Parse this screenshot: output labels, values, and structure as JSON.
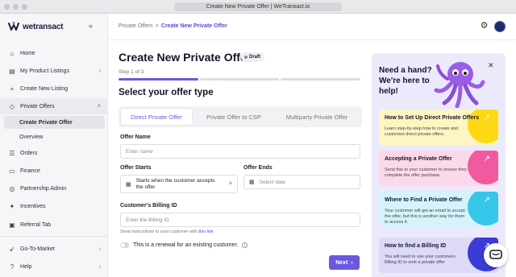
{
  "browser": {
    "title": "Create New Private Offer | WeTransact.io"
  },
  "brand": {
    "name": "wetransact",
    "accent": "#6a59de"
  },
  "sidebar": {
    "items": [
      {
        "label": "Home",
        "icon": "home-icon"
      },
      {
        "label": "My Product Listings",
        "icon": "listings-icon"
      },
      {
        "label": "Create New Listing",
        "icon": "plus-icon"
      },
      {
        "label": "Private Offers",
        "icon": "tag-icon"
      },
      {
        "label": "Orders",
        "icon": "orders-icon"
      },
      {
        "label": "Finance",
        "icon": "finance-icon"
      },
      {
        "label": "Partnership Admin",
        "icon": "partnership-icon"
      },
      {
        "label": "Incentives",
        "icon": "incentives-icon"
      },
      {
        "label": "Referral Tab",
        "icon": "referral-icon"
      },
      {
        "label": "Go-To-Market",
        "icon": "rocket-icon"
      },
      {
        "label": "Help",
        "icon": "help-icon"
      }
    ],
    "private_offers_sub": [
      "Create Private Offer",
      "Overview"
    ]
  },
  "header": {
    "crumbs": {
      "parent": "Private Offers",
      "sep": ">",
      "current": "Create New Private Offer"
    }
  },
  "main": {
    "title": "Create New Private Offer",
    "draft_badge": "Draft",
    "step": "Step 1 of 3",
    "progress": {
      "current_step": 1,
      "total_steps": 3
    },
    "section_title": "Select your offer type",
    "tabs": [
      "Direct Private Offer",
      "Private Offer to CSP",
      "Multiparty Private Offer"
    ],
    "offer_name": {
      "label": "Offer Name",
      "placeholder": "Enter name"
    },
    "offer_starts": {
      "label": "Offer Starts",
      "value": "Starts when the customer accepts the offer"
    },
    "offer_ends": {
      "label": "Offer Ends",
      "placeholder": "Select date"
    },
    "billing_id": {
      "label": "Customer's Billing ID",
      "placeholder": "Enter the Billing ID"
    },
    "hint": {
      "text": "Send instructions to your customer with",
      "link": "this link"
    },
    "renewal_label": "This is a renewal for an existing customer.",
    "next_label": "Next"
  },
  "help": {
    "title": "Need a hand? We're here to help!",
    "cards": [
      {
        "title": "How to Set Up Direct Private Offers",
        "desc": "Learn step-by-step how to create and customize direct private offers.",
        "bg": "#fdf6c3",
        "blob": "#ffd814"
      },
      {
        "title": "Accepting a Private Offer",
        "desc": "Send this to your customer to ensure they complete the offer purchase.",
        "bg": "#fbd9ea",
        "blob": "#f25aa0"
      },
      {
        "title": "Where to Find a Private Offer",
        "desc": "Your customer will get an email to accept the offer, but this is another way for them to access it.",
        "bg": "#d4f4fb",
        "blob": "#36c6ea"
      },
      {
        "title": "How to find a Billing ID",
        "desc": "You will need to use your customers Billing ID to emit a private offer",
        "bg": "#dcdaf7",
        "blob": "#3b3bd6"
      }
    ]
  }
}
